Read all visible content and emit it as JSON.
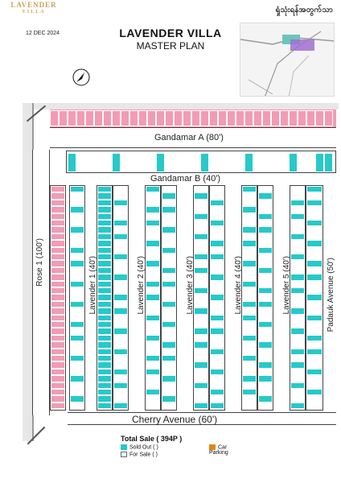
{
  "header": {
    "logo_top": "LAVENDER",
    "logo_bottom": "VILLA",
    "myanmar_title": "ရှုံသုံးရန်အတွက်သာ",
    "date": "12 DEC 2024",
    "title": "LAVENDER VILLA",
    "subtitle": "MASTER PLAN"
  },
  "roads": {
    "gandamar_a": "Gandamar A (80')",
    "gandamar_b": "Gandamar B (40')",
    "rose": "Rose 1 (100')",
    "cherry": "Cherry Avenue (60')",
    "padauk": "Padauk Avenue (50')",
    "lav1": "Lavender 1 (40')",
    "lav2": "Lavender 2 (40')",
    "lav3": "Lavender 3 (40')",
    "lav4": "Lavender 4 (40')",
    "lav5": "Lavender 5 (40')"
  },
  "colors": {
    "sold": "#27c9c9",
    "reserved": "#f39bb5",
    "parking": "#e0861a"
  },
  "legend": {
    "total": "Total Sale ( 394P )",
    "sold": "Sold Out ( )",
    "for_sale": "For Sale ( )",
    "parking": "Car Parking"
  }
}
